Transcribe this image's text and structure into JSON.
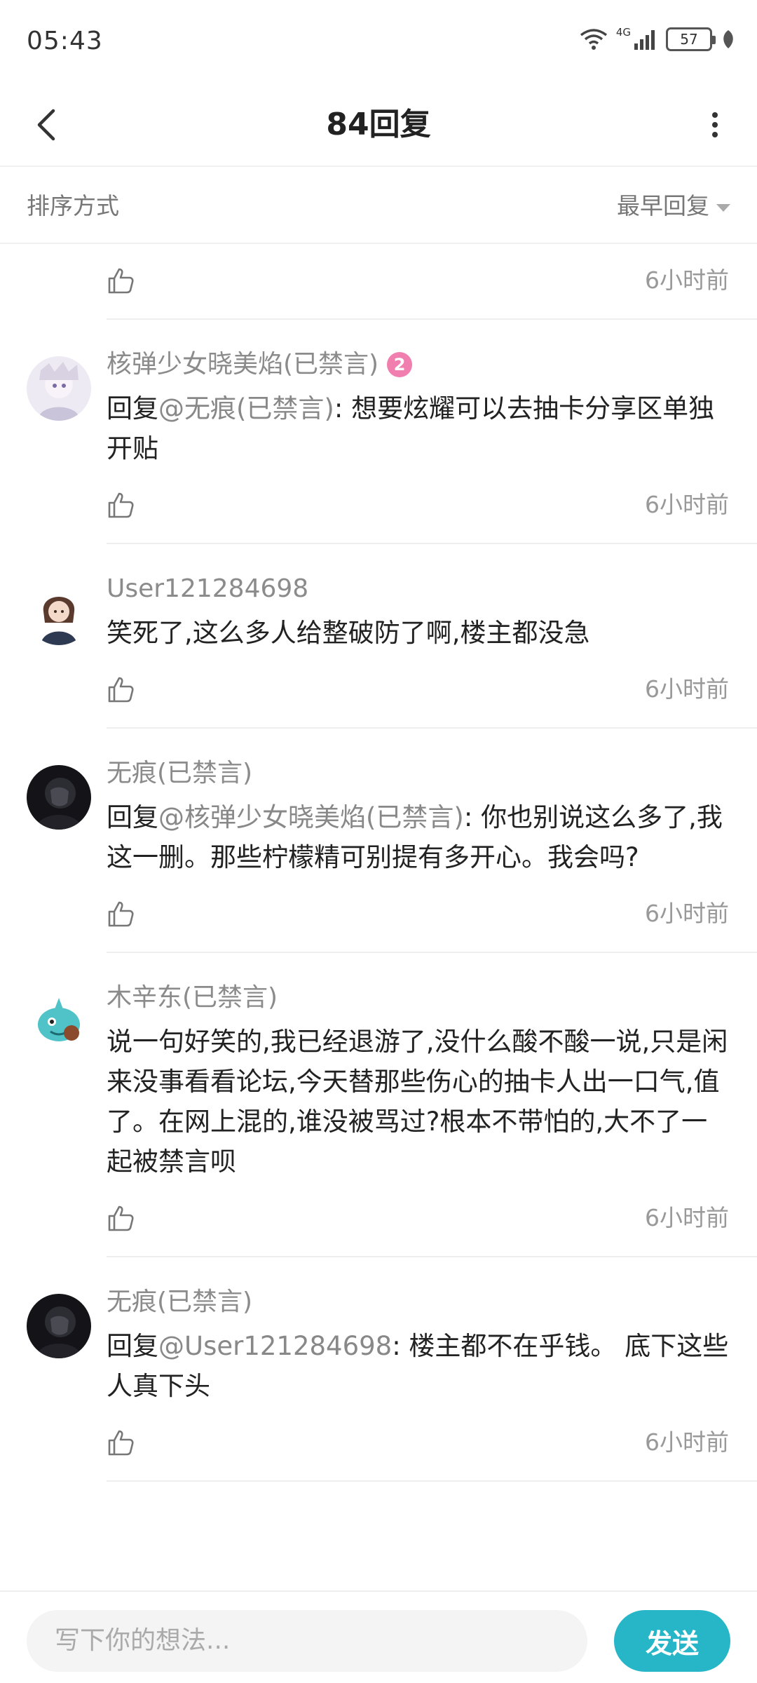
{
  "status_bar": {
    "time": "05:43",
    "network": "4G",
    "battery": "57"
  },
  "header": {
    "title": "84回复"
  },
  "sort": {
    "label": "排序方式",
    "selected": "最早回复"
  },
  "partial_top": {
    "time": "6小时前"
  },
  "comments": [
    {
      "username": "核弹少女晓美焰(已禁言)",
      "level": "2",
      "reply_prefix": "回复",
      "mention": "@无痕(已禁言)",
      "text": ": 想要炫耀可以去抽卡分享区单独开贴",
      "time": "6小时前",
      "avatar_color": "#e9e4f0"
    },
    {
      "username": "User121284698",
      "text": "笑死了,这么多人给整破防了啊,楼主都没急",
      "time": "6小时前",
      "avatar_color": "#d9d0cc"
    },
    {
      "username": "无痕(已禁言)",
      "reply_prefix": "回复",
      "mention": "@核弹少女晓美焰(已禁言)",
      "text": ": 你也别说这么多了,我这一删。那些柠檬精可别提有多开心。我会吗?",
      "time": "6小时前",
      "avatar_color": "#1f1f24"
    },
    {
      "username": "木辛东(已禁言)",
      "text": "说一句好笑的,我已经退游了,没什么酸不酸一说,只是闲来没事看看论坛,今天替那些伤心的抽卡人出一口气,值了。在网上混的,谁没被骂过?根本不带怕的,大不了一起被禁言呗",
      "time": "6小时前",
      "avatar_color": "#4fc3c8"
    },
    {
      "username": "无痕(已禁言)",
      "reply_prefix": "回复",
      "mention": "@User121284698",
      "text": ": 楼主都不在乎钱。 底下这些人真下头",
      "time": "6小时前",
      "avatar_color": "#1f1f24"
    }
  ],
  "input_bar": {
    "placeholder": "写下你的想法...",
    "send_label": "发送"
  },
  "colors": {
    "accent": "#26b6c8",
    "badge": "#f07fb0",
    "muted_text": "#8b8b8b"
  }
}
